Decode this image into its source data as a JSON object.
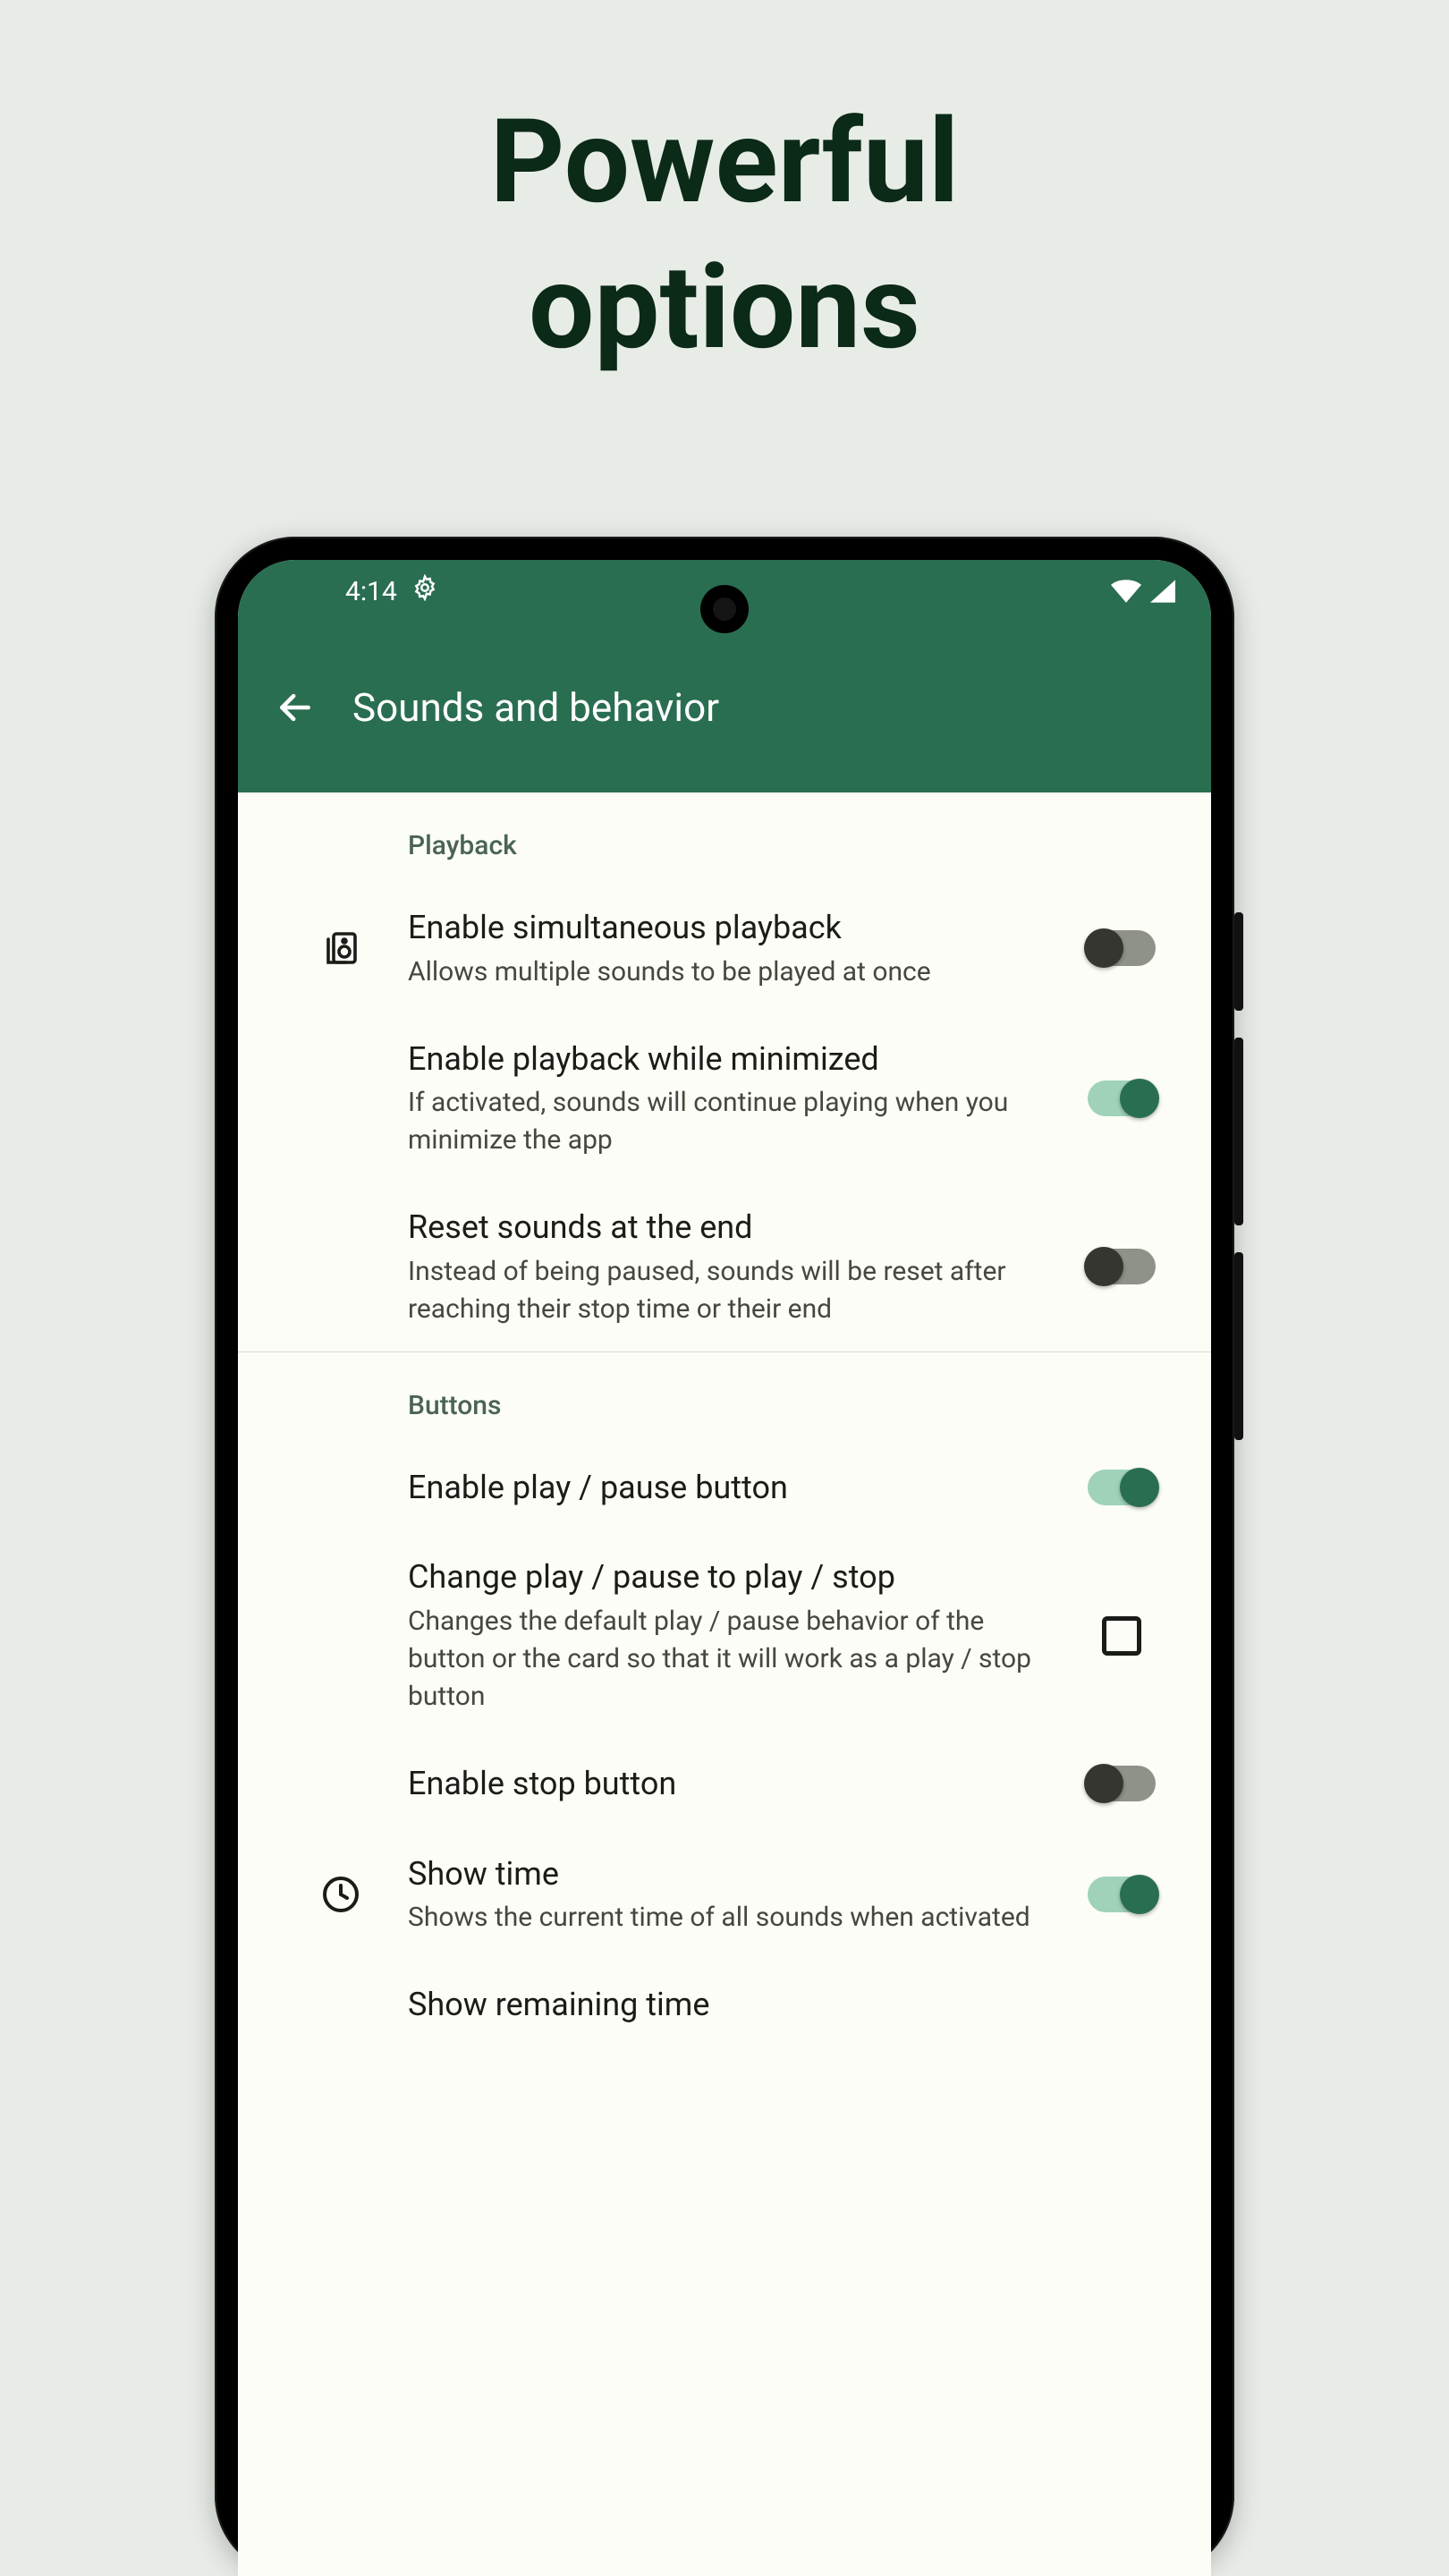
{
  "promo": {
    "line1": "Powerful",
    "line2": "options"
  },
  "statusbar": {
    "time": "4:14"
  },
  "appbar": {
    "title": "Sounds and behavior"
  },
  "sections": {
    "playback": {
      "header": "Playback"
    },
    "buttons": {
      "header": "Buttons"
    }
  },
  "settings": {
    "simultaneous": {
      "title": "Enable simultaneous playback",
      "sub": "Allows multiple sounds to be played at once",
      "on": false
    },
    "minimized": {
      "title": "Enable playback while minimized",
      "sub": "If activated, sounds will continue playing when you minimize the app",
      "on": true
    },
    "reset_end": {
      "title": "Reset sounds at the end",
      "sub": "Instead of being paused, sounds will be reset after reaching their stop time or their end",
      "on": false
    },
    "play_pause": {
      "title": "Enable play / pause button",
      "on": true
    },
    "play_stop": {
      "title": "Change play / pause to play / stop",
      "sub": "Changes the default play / pause behavior of the button or the card so that it will work as a play / stop button",
      "checked": false
    },
    "stop_btn": {
      "title": "Enable stop button",
      "on": false
    },
    "show_time": {
      "title": "Show time",
      "sub": "Shows the current time of all sounds when activated",
      "on": true
    },
    "show_remaining": {
      "title": "Show remaining time"
    }
  }
}
